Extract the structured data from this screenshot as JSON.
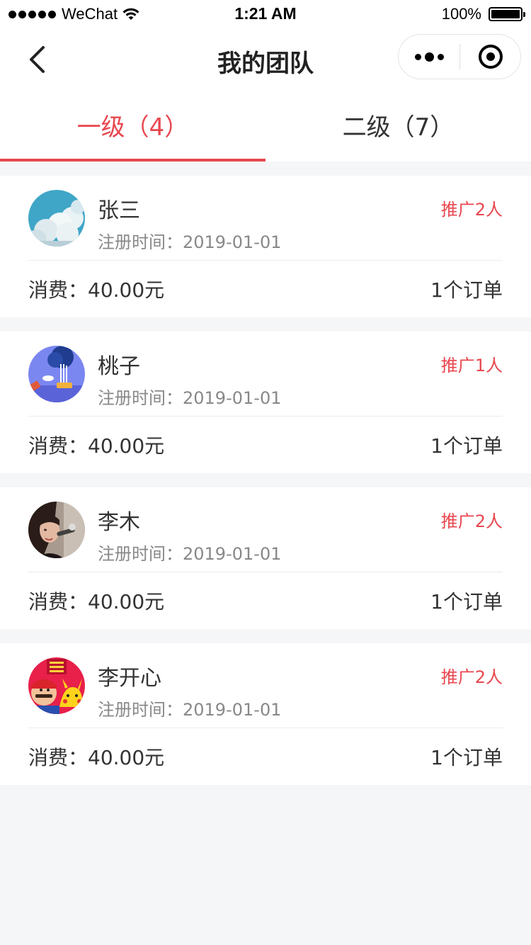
{
  "status_bar": {
    "carrier": "WeChat",
    "time": "1:21 AM",
    "battery": "100%"
  },
  "nav": {
    "title": "我的团队"
  },
  "tabs": [
    {
      "label": "一级（4）",
      "active": true
    },
    {
      "label": "二级（7）",
      "active": false
    }
  ],
  "members": [
    {
      "name": "张三",
      "reg_label": "注册时间：",
      "reg_date": "2019-01-01",
      "promo": "推广2人",
      "spend_label": "消费：",
      "spend": "40.00元",
      "orders": "1个订单",
      "avatar": "sky-clouds"
    },
    {
      "name": "桃子",
      "reg_label": "注册时间：",
      "reg_date": "2019-01-01",
      "promo": "推广1人",
      "spend_label": "消费：",
      "spend": "40.00元",
      "orders": "1个订单",
      "avatar": "blue-tree"
    },
    {
      "name": "李木",
      "reg_label": "注册时间：",
      "reg_date": "2019-01-01",
      "promo": "推广2人",
      "spend_label": "消费：",
      "spend": "40.00元",
      "orders": "1个订单",
      "avatar": "woman-photo"
    },
    {
      "name": "李开心",
      "reg_label": "注册时间：",
      "reg_date": "2019-01-01",
      "promo": "推广2人",
      "spend_label": "消费：",
      "spend": "40.00元",
      "orders": "1个订单",
      "avatar": "cartoon-red"
    }
  ],
  "colors": {
    "accent": "#e8474f",
    "background": "#f5f6f8"
  }
}
